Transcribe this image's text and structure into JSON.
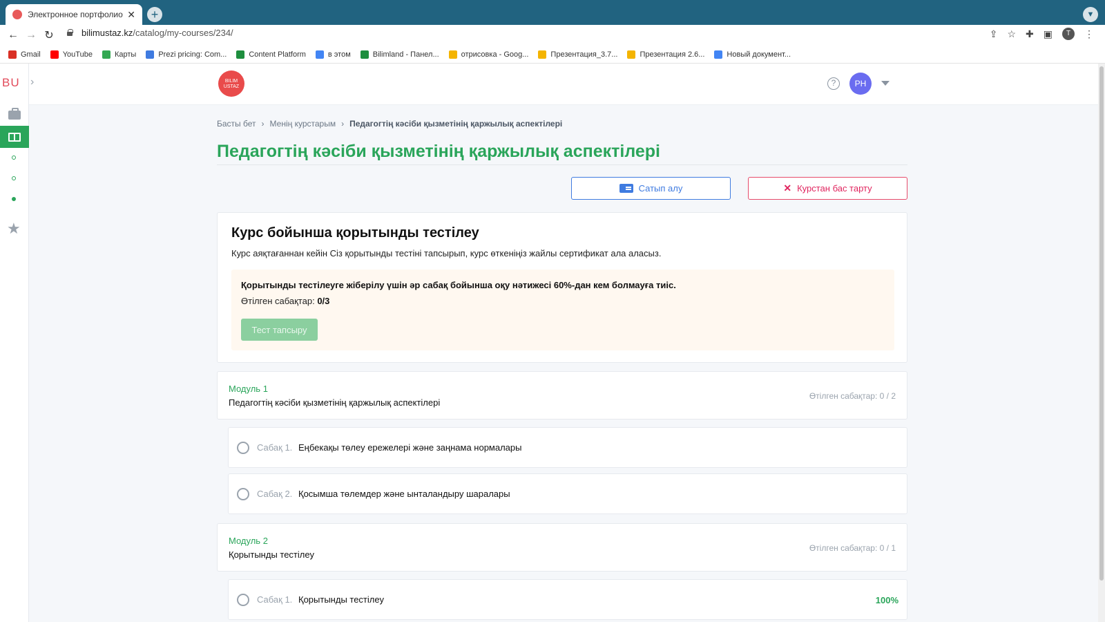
{
  "browser": {
    "tab_title": "Электронное портфолио. Пор",
    "url_host": "bilimustaz.kz",
    "url_path": "/catalog/my-courses/234/",
    "profile_initial": "T",
    "bookmarks": [
      {
        "label": "Gmail",
        "color": "#d93025"
      },
      {
        "label": "YouTube",
        "color": "#ff0000"
      },
      {
        "label": "Карты",
        "color": "#34a853"
      },
      {
        "label": "Prezi pricing: Com...",
        "color": "#3f7be0"
      },
      {
        "label": "Content Platform",
        "color": "#1e8e3e"
      },
      {
        "label": "в этом",
        "color": "#4285f4"
      },
      {
        "label": "Bilimland - Панел...",
        "color": "#1e8e3e"
      },
      {
        "label": "отрисовка - Goog...",
        "color": "#f4b400"
      },
      {
        "label": "Презентация_3.7...",
        "color": "#f4b400"
      },
      {
        "label": "Презентация 2.6...",
        "color": "#f4b400"
      },
      {
        "label": "Новый документ...",
        "color": "#4285f4"
      }
    ]
  },
  "app": {
    "logo_short": "BU",
    "brand_text": "BILIM USTAZ",
    "avatar": "PH",
    "help_icon": "?"
  },
  "breadcrumb": {
    "home": "Басты бет",
    "my_courses": "Менің курстарым",
    "current": "Педагогтің кәсіби қызметінің қаржылық аспектілері"
  },
  "page": {
    "title": "Педагогтің кәсіби қызметінің қаржылық аспектілері",
    "buy_label": "Сатып алу",
    "cancel_label": "Курстан бас тарту"
  },
  "final_test": {
    "heading": "Курс бойынша қорытынды тестілеу",
    "description": "Курс аяқтағаннан кейін Сіз қорытынды тестіні тапсырып, курс өткеніңіз жайлы сертификат ала аласыз.",
    "requirement": "Қорытынды тестілеуге жіберілу үшін әр сабақ бойынша оқу нәтижесі 60%-дан кем болмауға тиіс.",
    "passed_label": "Өтілген сабақтар: ",
    "passed_value": "0/3",
    "button_label": "Тест тапсыру"
  },
  "modules": [
    {
      "label": "Модуль 1",
      "name": "Педагогтің кәсіби қызметінің қаржылық аспектілері",
      "progress": "Өтілген сабақтар: 0 / 2",
      "lessons": [
        {
          "number": "Сабақ 1.",
          "name": "Еңбекақы төлеу ережелері және заңнама нормалары",
          "percent": ""
        },
        {
          "number": "Сабақ 2.",
          "name": "Қосымша төлемдер және ынталандыру шаралары",
          "percent": ""
        }
      ]
    },
    {
      "label": "Модуль 2",
      "name": "Қорытынды тестілеу",
      "progress": "Өтілген сабақтар: 0 / 1",
      "lessons": [
        {
          "number": "Сабақ 1.",
          "name": "Қорытынды тестілеу",
          "percent": "100%"
        }
      ]
    }
  ]
}
